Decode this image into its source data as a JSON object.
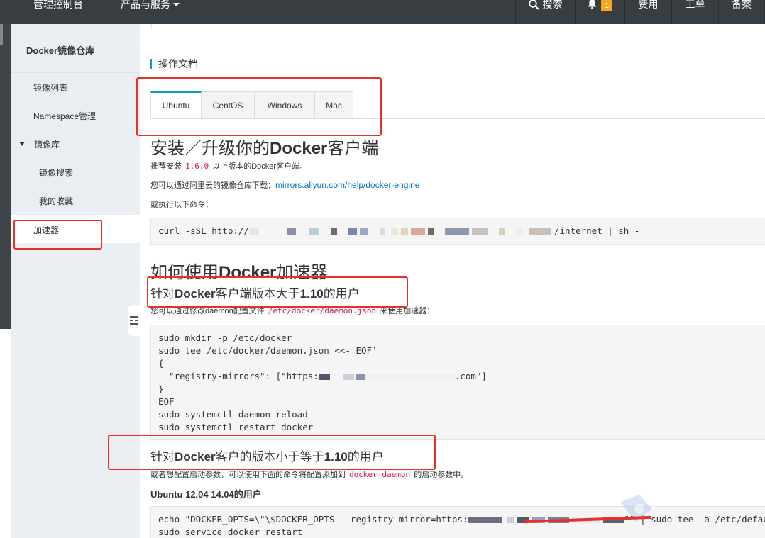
{
  "topbar": {
    "console": "管理控制台",
    "products": "产品与服务",
    "search": "搜索",
    "notification_count": "1",
    "fee": "费用",
    "ticket": "工单",
    "record": "备案"
  },
  "sidebar": {
    "title": "Docker镜像仓库",
    "items": [
      {
        "label": "镜像列表"
      },
      {
        "label": "Namespace管理"
      },
      {
        "label": "镜像库"
      },
      {
        "label": "镜像搜索"
      },
      {
        "label": "我的收藏"
      },
      {
        "label": "加速器"
      }
    ]
  },
  "main": {
    "section_title": "操作文档",
    "tabs": [
      "Ubuntu",
      "CentOS",
      "Windows",
      "Mac"
    ],
    "install_heading_a": "安装／升级你的",
    "install_heading_b": "Docker",
    "install_heading_c": "客户端",
    "recommend_prefix": "推荐安装 ",
    "recommend_version": "1.6.0",
    "recommend_suffix": " 以上版本的Docker客户端。",
    "download_prefix": "您可以通过阿里云的镜像仓库下载：",
    "download_link": "mirrors.aliyun.com/help/docker-engine",
    "or_exec": "或执行以下命令：",
    "curl_prefix": "curl -sSL http://",
    "curl_suffix": "/internet | sh -",
    "accel_heading_a": "如何使用",
    "accel_heading_b": "Docker",
    "accel_heading_c": "加速器",
    "gt_heading_a": "针对",
    "gt_heading_b": "Docker",
    "gt_heading_c": "客户端版本大于",
    "gt_heading_d": "1.10",
    "gt_heading_e": "的用户",
    "daemon_prefix": "您可以通过修改daemon配置文件 ",
    "daemon_file": "/etc/docker/daemon.json",
    "daemon_suffix": " 来使用加速器：",
    "code_lines": [
      "sudo mkdir -p /etc/docker",
      "sudo tee /etc/docker/daemon.json <<-'EOF'",
      "{",
      "EOF",
      "sudo systemctl daemon-reload",
      "sudo systemctl restart docker"
    ],
    "mirror_line_prefix": "  \"registry-mirrors\": [\"https:",
    "mirror_line_suffix": ".com\"]",
    "closing_brace": "}",
    "le_heading_a": "针对",
    "le_heading_b": "Docker",
    "le_heading_c": "客户的版本小于等于",
    "le_heading_d": "1.10",
    "le_heading_e": "的用户",
    "startup_prefix": "或者想配置启动参数，可以使用下面的命令将配置添加到 ",
    "startup_code": "docker daemon",
    "startup_suffix": " 的启动参数中。",
    "ubuntu_users": "Ubuntu 12.04 14.04的用户",
    "echo_prefix": "echo \"DOCKER_OPTS=\\\"\\$DOCKER_OPTS --registry-mirror=https:",
    "echo_suffix": "\"\" | sudo tee -a /etc/default/docker",
    "service_restart": "sudo service docker restart"
  },
  "colors": {
    "topbar": "#373d41",
    "sidebar": "#eaedf1",
    "accent": "#00a2ca",
    "annotation": "#e4322b",
    "link": "#0073bb"
  }
}
